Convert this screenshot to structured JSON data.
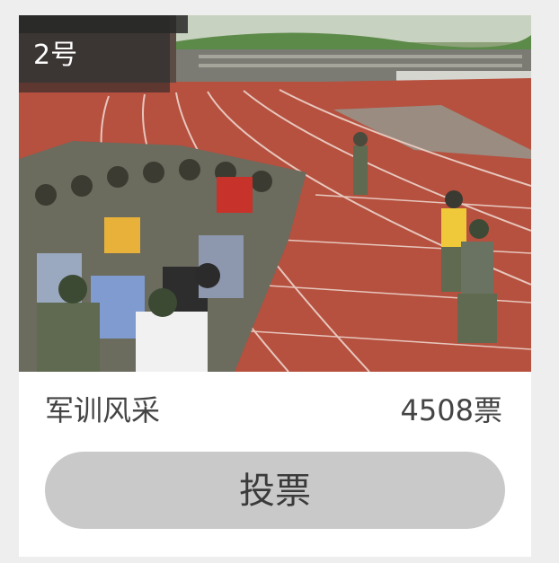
{
  "card": {
    "number_label": "2号",
    "photo_description_icon": "photo-military-training",
    "title": "军训风采",
    "votes": "4508票",
    "vote_button_label": "投票"
  },
  "colors": {
    "track": "#b6503f",
    "grass": "#3f8a3a",
    "button_bg": "#c9c9c9",
    "badge_bg": "#333333"
  }
}
